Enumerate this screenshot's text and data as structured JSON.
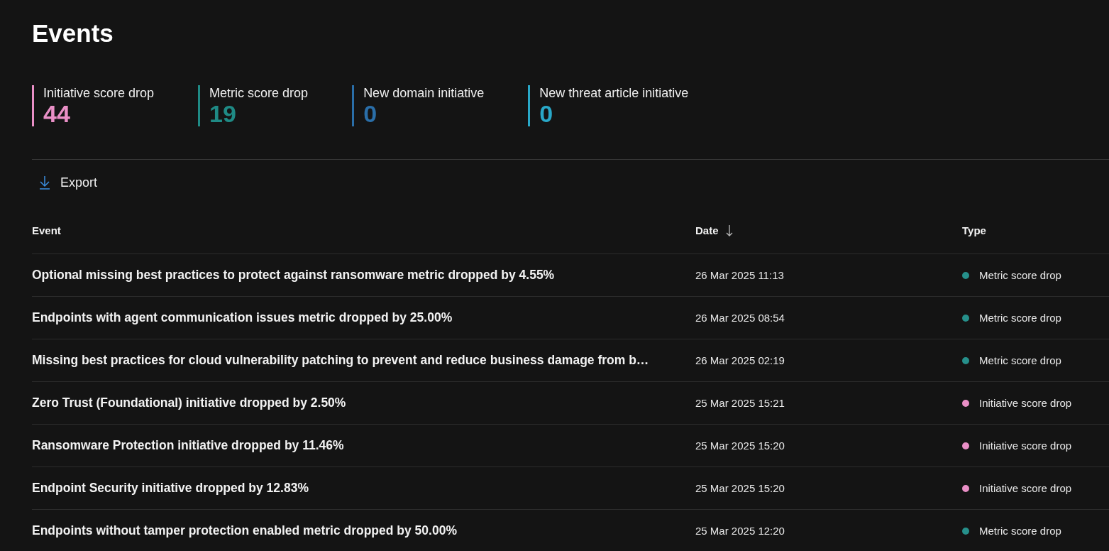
{
  "title": "Events",
  "stats": [
    {
      "label": "Initiative score drop",
      "value": "44",
      "color": "#e98fc6"
    },
    {
      "label": "Metric score drop",
      "value": "19",
      "color": "#1f8a85"
    },
    {
      "label": "New domain initiative",
      "value": "0",
      "color": "#2a6ea8"
    },
    {
      "label": "New threat article initiative",
      "value": "0",
      "color": "#29a8c8"
    }
  ],
  "toolbar": {
    "export_label": "Export"
  },
  "table": {
    "columns": [
      {
        "label": "Event",
        "sorted": false
      },
      {
        "label": "Date",
        "sorted": true
      },
      {
        "label": "Type",
        "sorted": false
      }
    ],
    "rows": [
      {
        "event": "Optional missing best practices to protect against ransomware metric dropped by 4.55%",
        "date": "26 Mar 2025 11:13",
        "type": "Metric score drop",
        "color": "#26908b"
      },
      {
        "event": "Endpoints with agent communication issues metric dropped by 25.00%",
        "date": "26 Mar 2025 08:54",
        "type": "Metric score drop",
        "color": "#26908b"
      },
      {
        "event": "Missing best practices for cloud vulnerability patching to prevent and reduce business damage from b…",
        "date": "26 Mar 2025 02:19",
        "type": "Metric score drop",
        "color": "#26908b"
      },
      {
        "event": "Zero Trust (Foundational) initiative dropped by 2.50%",
        "date": "25 Mar 2025 15:21",
        "type": "Initiative score drop",
        "color": "#e98fc6"
      },
      {
        "event": "Ransomware Protection initiative dropped by 11.46%",
        "date": "25 Mar 2025 15:20",
        "type": "Initiative score drop",
        "color": "#e98fc6"
      },
      {
        "event": "Endpoint Security initiative dropped by 12.83%",
        "date": "25 Mar 2025 15:20",
        "type": "Initiative score drop",
        "color": "#e98fc6"
      },
      {
        "event": "Endpoints without tamper protection enabled metric dropped by 50.00%",
        "date": "25 Mar 2025 12:20",
        "type": "Metric score drop",
        "color": "#26908b"
      }
    ]
  }
}
